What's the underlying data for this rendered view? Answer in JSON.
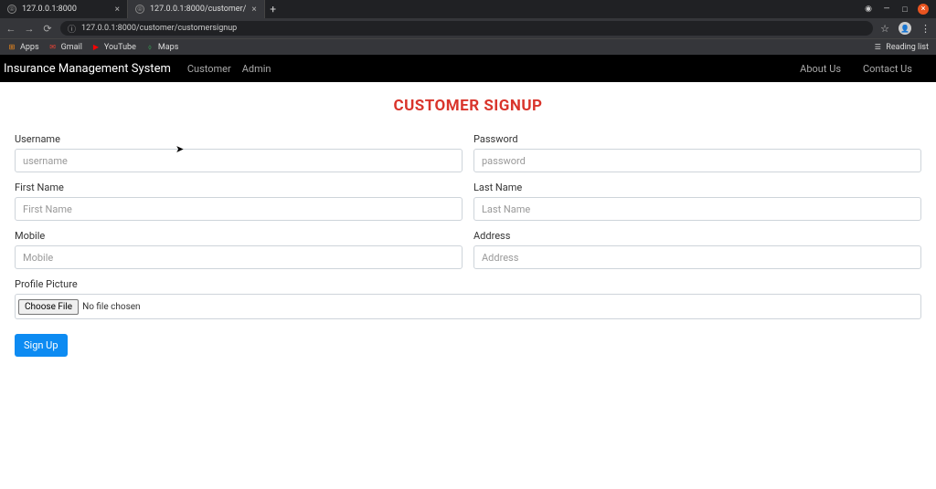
{
  "browser": {
    "tabs": [
      {
        "title": "127.0.0.1:8000"
      },
      {
        "title": "127.0.0.1:8000/customer/"
      }
    ],
    "url": "127.0.0.1:8000/customer/customersignup",
    "bookmarks": {
      "apps": "Apps",
      "gmail": "Gmail",
      "youtube": "YouTube",
      "maps": "Maps",
      "reading_list": "Reading list"
    }
  },
  "navbar": {
    "brand": "Insurance Management System",
    "links": {
      "customer": "Customer",
      "admin": "Admin",
      "about": "About Us",
      "contact": "Contact Us"
    }
  },
  "page": {
    "title": "CUSTOMER SIGNUP"
  },
  "form": {
    "username": {
      "label": "Username",
      "placeholder": "username"
    },
    "password": {
      "label": "Password",
      "placeholder": "password"
    },
    "first_name": {
      "label": "First Name",
      "placeholder": "First Name"
    },
    "last_name": {
      "label": "Last Name",
      "placeholder": "Last Name"
    },
    "mobile": {
      "label": "Mobile",
      "placeholder": "Mobile"
    },
    "address": {
      "label": "Address",
      "placeholder": "Address"
    },
    "profile_pic": {
      "label": "Profile Picture",
      "button": "Choose File",
      "status": "No file chosen"
    },
    "submit": "Sign Up"
  }
}
